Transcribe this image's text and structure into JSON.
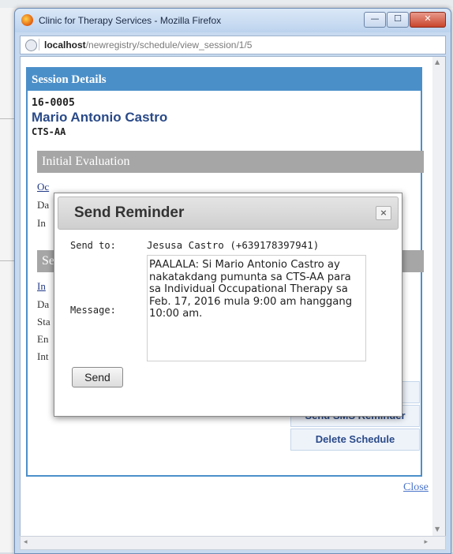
{
  "window": {
    "title": "Clinic for Therapy Services - Mozilla Firefox",
    "controls": {
      "minimize": "—",
      "maximize": "☐",
      "close": "✕"
    }
  },
  "browser": {
    "url_domain": "localhost",
    "url_path": "/newregistry/schedule/view_session/1/5"
  },
  "session": {
    "header": "Session Details",
    "patient_id": "16-0005",
    "patient_name": "Mario Antonio Castro",
    "clinic_code": "CTS-AA",
    "section1": {
      "title": "Initial Evaluation",
      "fragments": [
        "Oc",
        "Da",
        "In"
      ]
    },
    "section2": {
      "title": "Se",
      "fragments": [
        "In",
        "Da",
        "Sta",
        "En",
        "Int"
      ]
    },
    "actions": {
      "send_sms": "Send SMS Reminder",
      "delete": "Delete Schedule"
    },
    "close_link": "Close"
  },
  "modal": {
    "title": "Send Reminder",
    "close_icon": "×",
    "send_to_label": "Send to:",
    "send_to_value": "Jesusa Castro (+639178397941)",
    "message_label": "Message:",
    "message_text": "PAALALA: Si Mario Antonio Castro ay nakatakdang pumunta sa CTS-AA para sa Individual Occupational Therapy sa Feb. 17, 2016 mula 9:00 am hanggang 10:00 am.",
    "send_button": "Send"
  },
  "scrollbars": {
    "up": "▲",
    "down": "▼",
    "left": "◂",
    "right": "▸"
  },
  "colors": {
    "panel_header": "#4b8fc9",
    "section_header": "#a6a6a6",
    "patient_name": "#2a4a88",
    "link": "#4b74c9"
  },
  "icons": [
    "firefox-icon",
    "globe-icon",
    "minimize-icon",
    "maximize-icon",
    "close-icon",
    "modal-close-icon"
  ]
}
